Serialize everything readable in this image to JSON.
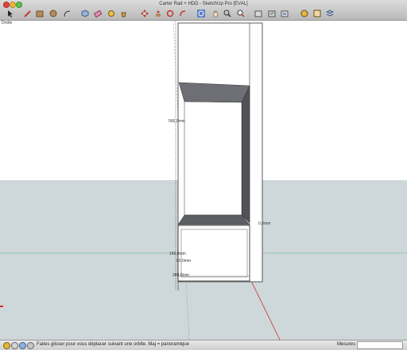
{
  "window": {
    "title": "Carter Rad + HDD - SketchUp Pro [EVAL]"
  },
  "toolbar": {
    "tools": [
      {
        "name": "select-tool",
        "icon": "arrow-icon"
      },
      {
        "name": "pencil-tool",
        "icon": "pencil-icon"
      },
      {
        "name": "rectangle-tool",
        "icon": "rectangle-icon"
      },
      {
        "name": "circle-tool",
        "icon": "circle-icon"
      },
      {
        "name": "arc-tool",
        "icon": "arc-icon"
      },
      {
        "name": "make-component-tool",
        "icon": "component-icon"
      },
      {
        "name": "eraser-tool",
        "icon": "eraser-icon"
      },
      {
        "name": "tape-measure-tool",
        "icon": "tape-icon"
      },
      {
        "name": "paint-bucket-tool",
        "icon": "bucket-icon"
      },
      {
        "name": "move-tool",
        "icon": "move-icon"
      },
      {
        "name": "push-pull-tool",
        "icon": "push-pull-icon"
      },
      {
        "name": "rotate-tool",
        "icon": "rotate-icon"
      },
      {
        "name": "follow-me-tool",
        "icon": "follow-me-icon"
      },
      {
        "name": "offset-tool",
        "icon": "offset-icon"
      },
      {
        "name": "orbit-tool",
        "icon": "orbit-icon"
      },
      {
        "name": "pan-tool",
        "icon": "hand-icon"
      },
      {
        "name": "zoom-tool",
        "icon": "magnifier-icon"
      },
      {
        "name": "zoom-extents-tool",
        "icon": "zoom-extents-icon"
      },
      {
        "name": "warehouse-tool",
        "icon": "warehouse-icon"
      },
      {
        "name": "share-model-tool",
        "icon": "share-icon"
      },
      {
        "name": "components-tool",
        "icon": "components-icon"
      },
      {
        "name": "extension-tool",
        "icon": "extension-icon"
      },
      {
        "name": "styles-tool",
        "icon": "styles-icon"
      },
      {
        "name": "layers-tool",
        "icon": "layers-icon"
      }
    ]
  },
  "viewport": {
    "scene_label": "Droite",
    "dimensions": {
      "height_upper": "566,0mm",
      "depth": "0,0mm",
      "d1": "166,0mm",
      "d2": "60,0mm",
      "d3": "380,0mm"
    }
  },
  "status": {
    "hint": "Faites glisser pour vous déplacer suivant une orbite.  Maj = panoramique",
    "mesures_label": "Mesures",
    "mesures_value": ""
  },
  "colors": {
    "sky": "#ffffff",
    "ground": "#ced7d9",
    "face": "#ffffff",
    "shade_dark": "#505258",
    "shade_mid": "#6d6f75",
    "axis_green": "#2bb24c",
    "axis_red": "#d0302a"
  }
}
